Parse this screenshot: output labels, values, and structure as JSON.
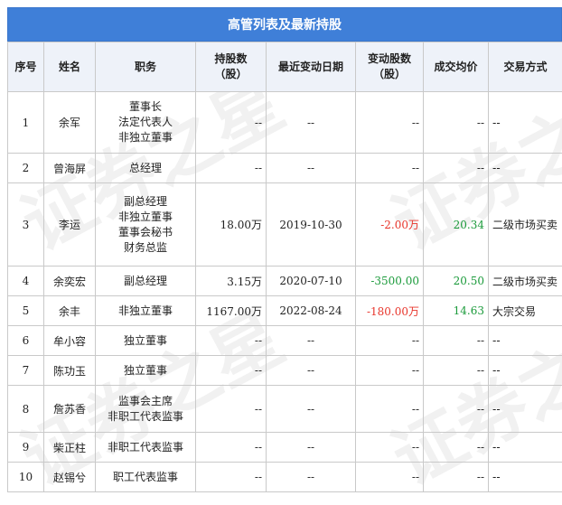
{
  "title": "高管列表及最新持股",
  "watermark": "证券之星",
  "columns": [
    "序号",
    "姓名",
    "职务",
    "持股数\n（股）",
    "最近变动日期",
    "变动股数\n（股）",
    "成交均价",
    "交易方式"
  ],
  "rows": [
    {
      "no": "1",
      "name": "余军",
      "roles": [
        "董事长",
        "法定代表人",
        "非独立董事"
      ],
      "shares": "--",
      "date": "--",
      "change": "--",
      "price": "--",
      "method": "--",
      "change_color": "",
      "price_color": ""
    },
    {
      "no": "2",
      "name": "曾海屏",
      "roles": [
        "总经理"
      ],
      "shares": "--",
      "date": "--",
      "change": "--",
      "price": "--",
      "method": "--",
      "change_color": "",
      "price_color": ""
    },
    {
      "no": "3",
      "name": "李运",
      "roles": [
        "副总经理",
        "非独立董事",
        "董事会秘书",
        "财务总监"
      ],
      "shares": "18.00万",
      "date": "2019-10-30",
      "change": "-2.00万",
      "price": "20.34",
      "method": "二级市场买卖",
      "change_color": "red",
      "price_color": "green"
    },
    {
      "no": "4",
      "name": "余奕宏",
      "roles": [
        "副总经理"
      ],
      "shares": "3.15万",
      "date": "2020-07-10",
      "change": "-3500.00",
      "price": "20.50",
      "method": "二级市场买卖",
      "change_color": "green",
      "price_color": "green"
    },
    {
      "no": "5",
      "name": "余丰",
      "roles": [
        "非独立董事"
      ],
      "shares": "1167.00万",
      "date": "2022-08-24",
      "change": "-180.00万",
      "price": "14.63",
      "method": "大宗交易",
      "change_color": "red",
      "price_color": "green"
    },
    {
      "no": "6",
      "name": "牟小容",
      "roles": [
        "独立董事"
      ],
      "shares": "--",
      "date": "--",
      "change": "--",
      "price": "--",
      "method": "--",
      "change_color": "",
      "price_color": ""
    },
    {
      "no": "7",
      "name": "陈功玉",
      "roles": [
        "独立董事"
      ],
      "shares": "--",
      "date": "--",
      "change": "--",
      "price": "--",
      "method": "--",
      "change_color": "",
      "price_color": ""
    },
    {
      "no": "8",
      "name": "詹苏香",
      "roles": [
        "监事会主席",
        "非职工代表监事"
      ],
      "shares": "--",
      "date": "--",
      "change": "--",
      "price": "--",
      "method": "--",
      "change_color": "",
      "price_color": ""
    },
    {
      "no": "9",
      "name": "柴正柱",
      "roles": [
        "非职工代表监事"
      ],
      "shares": "--",
      "date": "--",
      "change": "--",
      "price": "--",
      "method": "--",
      "change_color": "",
      "price_color": ""
    },
    {
      "no": "10",
      "name": "赵锡兮",
      "roles": [
        "职工代表监事"
      ],
      "shares": "--",
      "date": "--",
      "change": "--",
      "price": "--",
      "method": "--",
      "change_color": "",
      "price_color": ""
    }
  ]
}
